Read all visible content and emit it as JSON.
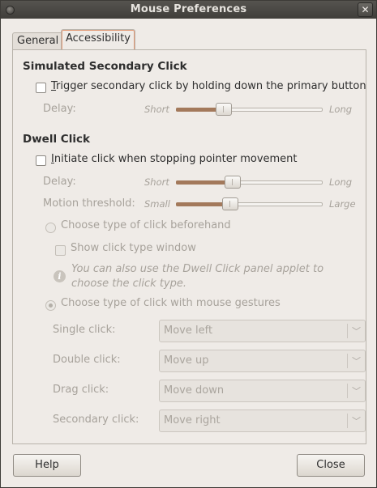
{
  "window": {
    "title": "Mouse Preferences",
    "close_glyph": "✕"
  },
  "tabs": [
    {
      "label": "General"
    },
    {
      "label": "Accessibility"
    }
  ],
  "secondary_click": {
    "heading": "Simulated Secondary Click",
    "trigger": {
      "label_u": "T",
      "label_rest": "rigger secondary click by holding down the primary button",
      "checked": false
    },
    "delay": {
      "label": "Delay:",
      "min_label": "Short",
      "max_label": "Long",
      "value": 0.3
    }
  },
  "dwell_click": {
    "heading": "Dwell Click",
    "initiate": {
      "label_u": "I",
      "label_rest": "nitiate click when stopping pointer movement",
      "checked": false
    },
    "delay": {
      "label": "Delay:",
      "min_label": "Short",
      "max_label": "Long",
      "value": 0.37
    },
    "motion": {
      "label": "Motion threshold:",
      "min_label": "Small",
      "max_label": "Large",
      "value": 0.35
    },
    "choose_beforehand": {
      "label": "Choose type of click beforehand",
      "selected": false
    },
    "show_window": {
      "label": "Show click type window",
      "checked": false
    },
    "info_glyph": "i",
    "info_text_1": "You can also use the Dwell Click panel applet to",
    "info_text_2": "choose the click type.",
    "choose_gestures": {
      "label": "Choose type of click with mouse gestures",
      "selected": true
    },
    "gestures": [
      {
        "label": "Single click:",
        "value": "Move left"
      },
      {
        "label": "Double click:",
        "value": "Move up"
      },
      {
        "label": "Drag click:",
        "value": "Move down"
      },
      {
        "label": "Secondary click:",
        "value": "Move right"
      }
    ],
    "chevron_glyph": "﹀"
  },
  "buttons": {
    "help": "Help",
    "close": "Close"
  },
  "colors": {
    "accent": "#e39c7a",
    "slider_fill": "#a3795b",
    "titlebar": "#4a4844"
  }
}
